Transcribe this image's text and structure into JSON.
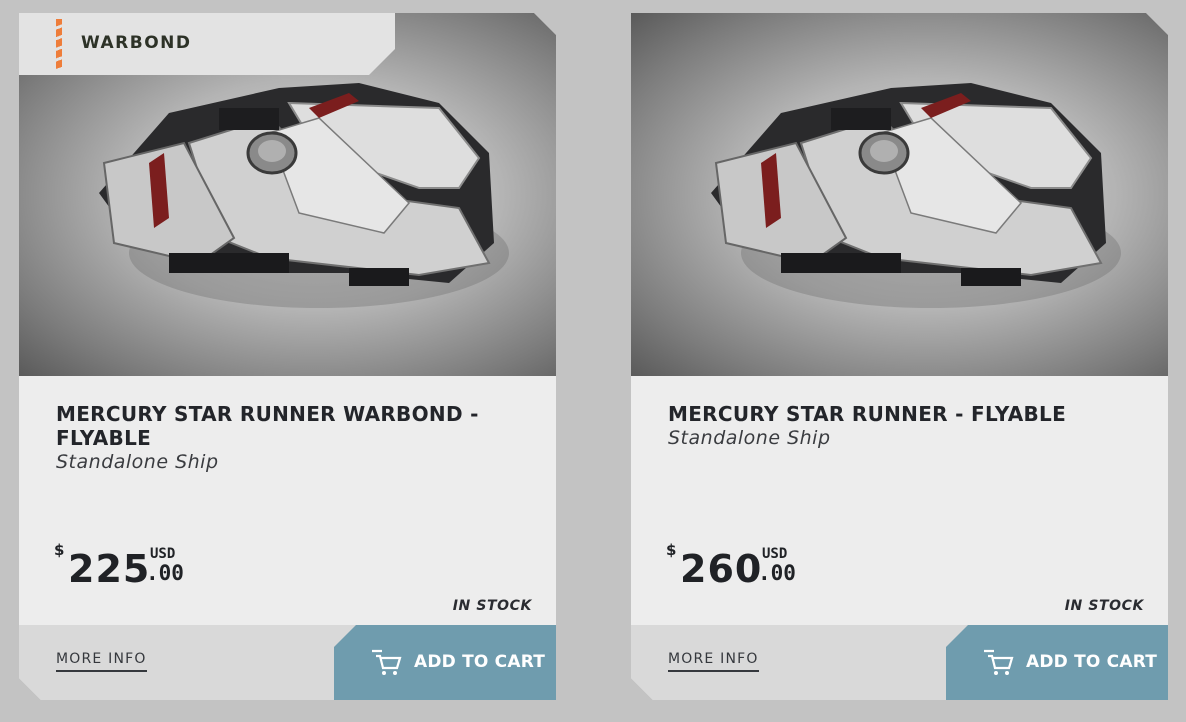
{
  "products": [
    {
      "badge": "WARBOND",
      "title": "MERCURY STAR RUNNER WARBOND - FLYABLE",
      "subtitle": "Standalone Ship",
      "price": {
        "currency_symbol": "$",
        "integer": "225",
        "cents": ".00",
        "unit": "USD"
      },
      "stock": "IN STOCK",
      "more_info": "MORE INFO",
      "add_to_cart": "ADD TO CART",
      "image_alt": "Mercury Star Runner ship"
    },
    {
      "title": "MERCURY STAR RUNNER - FLYABLE",
      "subtitle": "Standalone Ship",
      "price": {
        "currency_symbol": "$",
        "integer": "260",
        "cents": ".00",
        "unit": "USD"
      },
      "stock": "IN STOCK",
      "more_info": "MORE INFO",
      "add_to_cart": "ADD TO CART",
      "image_alt": "Mercury Star Runner ship"
    }
  ],
  "icons": {
    "cart": "cart-icon"
  },
  "colors": {
    "page_background": "#c3c3c3",
    "card_background": "#ededed",
    "cart_button": "#6f9cae",
    "badge_stripe": "#ee7d3a",
    "text_dark": "#23252a"
  }
}
